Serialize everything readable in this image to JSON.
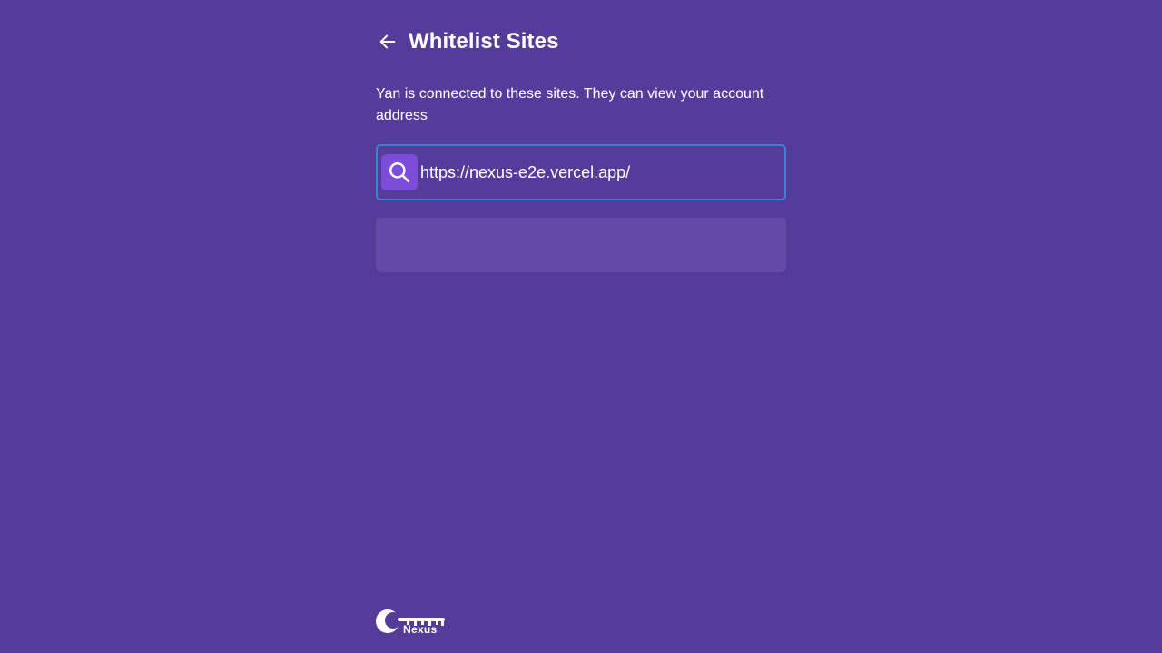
{
  "header": {
    "title": "Whitelist Sites",
    "back_icon": "arrow-left-icon"
  },
  "description": "Yan is connected to these sites. They can view your account address",
  "search": {
    "value": "https://nexus-e2e.vercel.app/",
    "icon": "search-icon"
  },
  "sites": [
    {
      "label": ""
    }
  ],
  "footer": {
    "logo_text": "Nexus"
  },
  "colors": {
    "background": "#553c9a",
    "search_border": "#3b82d6",
    "search_icon_bg": "#7c4ddb",
    "list_item_bg": "#644aa6",
    "text": "#ffffff"
  }
}
